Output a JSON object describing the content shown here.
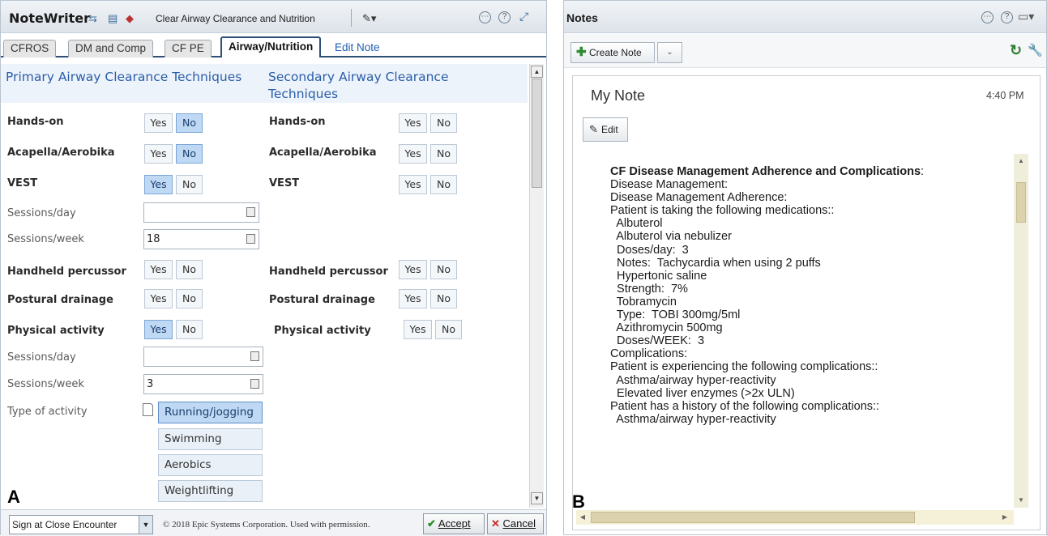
{
  "left_panel": {
    "app_name": "NoteWriter",
    "note_title": "Clear Airway Clearance and Nutrition",
    "tabs": [
      {
        "label": "CFROS"
      },
      {
        "label": "DM and Comp"
      },
      {
        "label": "CF PE"
      },
      {
        "label": "Airway/Nutrition",
        "active": true
      },
      {
        "label": "Edit Note"
      }
    ],
    "primary_header": "Primary Airway Clearance Techniques",
    "secondary_header_line1": "Secondary Airway Clearance",
    "secondary_header_line2": "Techniques",
    "yes_label": "Yes",
    "no_label": "No",
    "primary": [
      {
        "label": "Hands-on",
        "value": "No"
      },
      {
        "label": "Acapella/Aerobika",
        "value": "No"
      },
      {
        "label": "VEST",
        "value": "Yes"
      },
      {
        "label": "Sessions/day",
        "value": ""
      },
      {
        "label": "Sessions/week",
        "value": "18"
      },
      {
        "label": "Handheld percussor",
        "value": ""
      },
      {
        "label": "Postural drainage",
        "value": ""
      },
      {
        "label": "Physical activity",
        "value": "Yes"
      },
      {
        "label": "Sessions/day",
        "value": ""
      },
      {
        "label": "Sessions/week",
        "value": "3"
      },
      {
        "label": "Type of activity"
      }
    ],
    "secondary": [
      {
        "label": "Hands-on"
      },
      {
        "label": "Acapella/Aerobika"
      },
      {
        "label": "VEST"
      },
      {
        "label": "Handheld percussor"
      },
      {
        "label": "Postural drainage"
      },
      {
        "label": "Physical activity"
      }
    ],
    "activities": [
      {
        "label": "Running/jogging",
        "selected": true
      },
      {
        "label": "Swimming"
      },
      {
        "label": "Aerobics"
      },
      {
        "label": "Weightlifting"
      }
    ],
    "sign_option": "Sign at Close Encounter",
    "copyright": "© 2018 Epic Systems Corporation. Used with permission.",
    "accept_label": "Accept",
    "cancel_label": "Cancel",
    "figure_label": "A"
  },
  "right_panel": {
    "title": "Notes",
    "create_note_label": "Create Note",
    "note_name": "My Note",
    "note_time": "4:40 PM",
    "edit_label": "Edit",
    "figure_label": "B",
    "note_heading": "CF Disease Management Adherence and Complications",
    "note_heading_suffix": ":",
    "note_lines": [
      "Disease Management:",
      "Disease Management Adherence:",
      "Patient is taking the following medications::",
      "  Albuterol",
      "  Albuterol via nebulizer",
      "  Doses/day:  3",
      "  Notes:  Tachycardia when using 2 puffs",
      "  Hypertonic saline",
      "  Strength:  7%",
      "  Tobramycin",
      "  Type:  TOBI 300mg/5ml",
      "  Azithromycin 500mg",
      "  Doses/WEEK:  3",
      "Complications:",
      "Patient is experiencing the following complications::",
      "  Asthma/airway hyper-reactivity",
      "  Elevated liver enzymes (>2x ULN)",
      "Patient has a history of the following complications::",
      "  Asthma/airway hyper-reactivity"
    ]
  },
  "colors": {
    "selected_button": "#bfd9f5",
    "header_blue": "#2a5da8",
    "tab_border": "#2f4f76",
    "scroll_yellow": "#efeeda"
  }
}
